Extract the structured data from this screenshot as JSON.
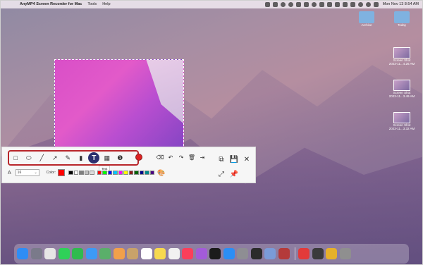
{
  "menubar": {
    "app_name": "AnyMP4 Screen Recorder for Mac",
    "menus": [
      "Tools",
      "Help"
    ],
    "clock": "Mon Nov 13  8:54 AM",
    "status_icons": [
      "battery-icon",
      "dropbox-icon",
      "circle-icon",
      "refresh-icon",
      "sliders-icon",
      "monitor-icon",
      "gear-icon",
      "audio-icon",
      "control-icon",
      "bluetooth-icon",
      "music-icon",
      "wifi-icon",
      "search-icon",
      "user-icon",
      "menu-icon"
    ]
  },
  "desktop_icons": [
    {
      "label": "Archive",
      "icon": "folder-icon"
    },
    {
      "label": "Today",
      "icon": "folder-icon"
    },
    {
      "label": "Screen Shot\n2023-11...4.26 AM",
      "icon": "screenshot-icon"
    },
    {
      "label": "Screen Shot\n2023-11...3.49 AM",
      "icon": "screenshot-icon"
    },
    {
      "label": "Screen Shot\n2023-11...3.32 AM",
      "icon": "screenshot-icon"
    }
  ],
  "toolbar": {
    "tools": [
      {
        "name": "rectangle-tool",
        "glyph": "□"
      },
      {
        "name": "ellipse-tool",
        "glyph": "⬭"
      },
      {
        "name": "line-tool",
        "glyph": "╱"
      },
      {
        "name": "arrow-tool",
        "glyph": "↗"
      },
      {
        "name": "pen-tool",
        "glyph": "✎"
      },
      {
        "name": "highlighter-tool",
        "glyph": "▮"
      },
      {
        "name": "text-tool",
        "glyph": "T"
      },
      {
        "name": "blur-tool",
        "glyph": "▦"
      },
      {
        "name": "step-tool",
        "glyph": "❶"
      }
    ],
    "text_tooltip": "Text",
    "font_size": "16",
    "color_label": "Color:",
    "font_label": "A",
    "current_color": "#ff0000",
    "swatches_group1": [
      "#000000",
      "#ffffff",
      "#808080",
      "#c0c0c0",
      "#dcdcdc"
    ],
    "swatches_group2": [
      "#ff0000",
      "#00ff00",
      "#0000ff",
      "#00c8ff",
      "#ff00ff",
      "#ffff00",
      "#8b1a1a",
      "#006400",
      "#00008b",
      "#008b8b",
      "#4b0082"
    ],
    "right_tools": [
      "record-icon",
      "eraser-icon",
      "undo-icon",
      "redo-icon",
      "delete-icon",
      "exit-icon"
    ],
    "side_tools": [
      "copy-icon",
      "save-icon",
      "close-icon",
      "fullscreen-icon",
      "pin-icon"
    ]
  },
  "dock": {
    "apps": [
      "finder",
      "launchpad",
      "safari",
      "messages",
      "facetime",
      "mail",
      "maps",
      "photos",
      "contacts",
      "calendar",
      "notes",
      "reminders",
      "music",
      "podcasts",
      "tv",
      "appstore",
      "settings",
      "terminal",
      "preview",
      "colorsync",
      "screenrecorder",
      "screenshot",
      "chrome",
      "utility"
    ],
    "colors": [
      "#2f8df5",
      "#7a7a8a",
      "#e6e6e6",
      "#2fd158",
      "#2fbb4e",
      "#3d9af5",
      "#5aaf6a",
      "#f1a04a",
      "#c8a26a",
      "#ffffff",
      "#f7d94f",
      "#f1f1f1",
      "#fb3e5a",
      "#a35bd9",
      "#1b1b1b",
      "#2b8ef5",
      "#8e8e93",
      "#2b2b2b",
      "#7a9bd8",
      "#b43a3a",
      "#e23a3a",
      "#3a3a3a",
      "#e6b02a",
      "#8f8f8f"
    ]
  }
}
